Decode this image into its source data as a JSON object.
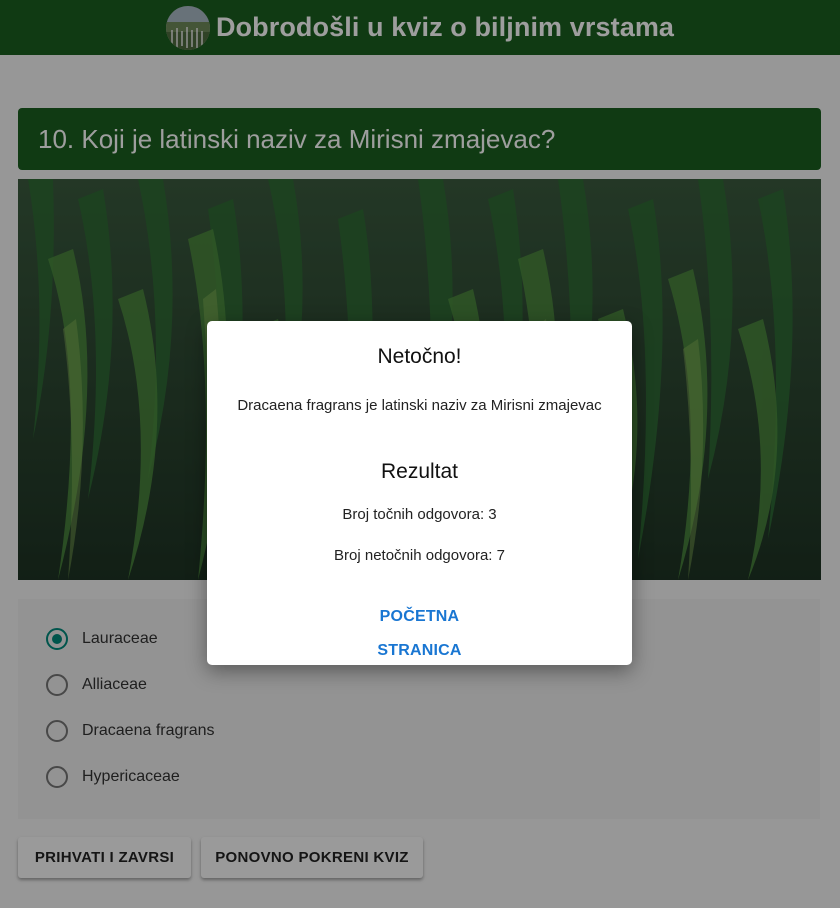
{
  "header": {
    "title": "Dobrodošli u kviz o biljnim vrstama",
    "logo_icon": "plant-field-icon"
  },
  "question": {
    "text": "10. Koji je latinski naziv za Mirisni zmajevac?",
    "image_icon": "dracaena-plant-photo"
  },
  "answers": [
    {
      "label": "Lauraceae",
      "selected": true
    },
    {
      "label": "Alliaceae",
      "selected": false
    },
    {
      "label": "Dracaena fragrans",
      "selected": false
    },
    {
      "label": "Hypericaceae",
      "selected": false
    }
  ],
  "buttons": {
    "finish": "PRIHVATI I ZAVRSI",
    "restart": "PONOVNO POKRENI KVIZ"
  },
  "dialog": {
    "title": "Netočno!",
    "message": "Dracaena fragrans je latinski naziv za Mirisni zmajevac",
    "result_title": "Rezultat",
    "correct": "Broj točnih odgovora: 3",
    "wrong": "Broj netočnih odgovora: 7",
    "home_link": "POČETNA STRANICA"
  },
  "colors": {
    "header_bg": "#1b5e20",
    "radio_accent": "#00897b",
    "link": "#1976d2"
  }
}
